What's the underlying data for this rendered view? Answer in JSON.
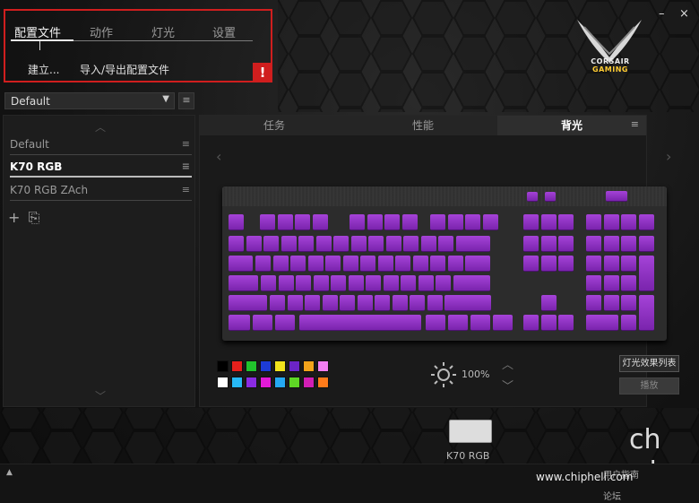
{
  "top_menu": {
    "tabs": [
      "配置文件",
      "动作",
      "灯光",
      "设置"
    ],
    "create_label": "建立...",
    "import_export_label": "导入/导出配置文件",
    "warning": "!"
  },
  "window": {
    "minimize": "–",
    "close": "×"
  },
  "logo": {
    "line1": "CORSAIR",
    "line2": "GAMING"
  },
  "profile_select": {
    "value": "Default",
    "arrow": "▼"
  },
  "profiles": [
    {
      "name": "Default"
    },
    {
      "name": "K70 RGB"
    },
    {
      "name": "K70 RGB ZAch"
    }
  ],
  "right_tabs": [
    "任务",
    "性能",
    "背光"
  ],
  "colors": {
    "row1": [
      "#000000",
      "#e5201c",
      "#21c32c",
      "#1d3bd6",
      "#f1e21c",
      "#6b24c6",
      "#f2a41b",
      "#f07ef0"
    ],
    "row2": [
      "#ffffff",
      "#27b8f5",
      "#8a2be2",
      "#e21ad8",
      "#25a9f3",
      "#5ed625",
      "#d11eb4",
      "#ff7b1a"
    ],
    "key_purple": "#9a36d0",
    "warning_red": "#d01e1e"
  },
  "brightness": {
    "value": "100%"
  },
  "buttons": {
    "effects_list": "灯光效果列表",
    "play": "播放"
  },
  "device": {
    "name": "K70 RGB"
  },
  "status": {
    "up": "▲",
    "link1": "用户指南",
    "link2": "论坛"
  },
  "watermark": {
    "text": "www.chiphell.com"
  },
  "icons": {
    "menu": "hamburger-icon",
    "add": "plus-icon",
    "import": "import-icon",
    "brightness": "sun-icon",
    "chev_up": "chevron-up-icon",
    "chev_down": "chevron-down-icon"
  }
}
